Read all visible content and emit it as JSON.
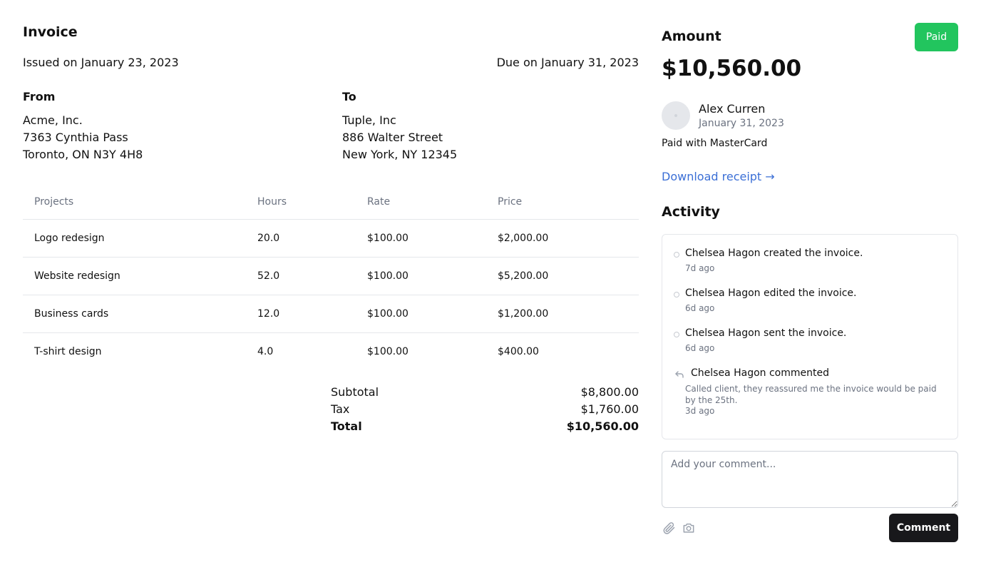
{
  "invoice": {
    "title": "Invoice",
    "issued": "Issued on January 23, 2023",
    "due": "Due on January 31, 2023",
    "from": {
      "label": "From",
      "lines": [
        "Acme, Inc.",
        "7363 Cynthia Pass",
        "Toronto, ON N3Y 4H8"
      ]
    },
    "to": {
      "label": "To",
      "lines": [
        "Tuple, Inc",
        "886 Walter Street",
        "New York, NY 12345"
      ]
    },
    "table": {
      "headers": [
        "Projects",
        "Hours",
        "Rate",
        "Price"
      ],
      "rows": [
        [
          "Logo redesign",
          "20.0",
          "$100.00",
          "$2,000.00"
        ],
        [
          "Website redesign",
          "52.0",
          "$100.00",
          "$5,200.00"
        ],
        [
          "Business cards",
          "12.0",
          "$100.00",
          "$1,200.00"
        ],
        [
          "T-shirt design",
          "4.0",
          "$100.00",
          "$400.00"
        ]
      ]
    },
    "totals": {
      "subtotal_label": "Subtotal",
      "subtotal_value": "$8,800.00",
      "tax_label": "Tax",
      "tax_value": "$1,760.00",
      "total_label": "Total",
      "total_value": "$10,560.00"
    }
  },
  "summary": {
    "amount_label": "Amount",
    "status": "Paid",
    "amount_value": "$10,560.00",
    "payer_name": "Alex Curren",
    "payer_date": "January 31, 2023",
    "paid_with": "Paid with MasterCard",
    "download_label": "Download receipt →"
  },
  "activity": {
    "title": "Activity",
    "items": [
      {
        "text": "Chelsea Hagon created the invoice.",
        "time": "7d ago"
      },
      {
        "text": "Chelsea Hagon edited the invoice.",
        "time": "6d ago"
      },
      {
        "text": "Chelsea Hagon sent the invoice.",
        "time": "6d ago"
      }
    ],
    "comment": {
      "text": "Chelsea Hagon commented",
      "body": "Called client, they reassured me the invoice would be paid by the 25th.",
      "time": "3d ago"
    }
  },
  "composer": {
    "placeholder": "Add your comment...",
    "button_label": "Comment"
  },
  "colors": {
    "paid_badge": "#22c55e",
    "link": "#3b6fd6",
    "comment_button": "#18181b"
  },
  "icons": [
    "paperclip-icon",
    "camera-icon",
    "reply-icon"
  ]
}
